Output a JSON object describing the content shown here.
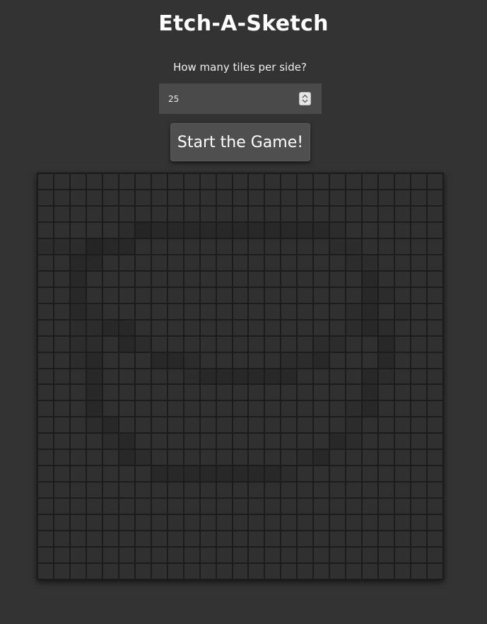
{
  "title": "Etch-A-Sketch",
  "prompt": "How many tiles per side?",
  "tiles_input": {
    "value": "25"
  },
  "start_button": {
    "label": "Start the Game!"
  },
  "grid": {
    "tiles_per_side": 25,
    "base_color": "#303030",
    "shaded": {
      "light": "#2c2c2c",
      "medium": "#282828",
      "dark": "#252525"
    },
    "drawn_tiles": [
      [
        3,
        5,
        "l"
      ],
      [
        3,
        6,
        "d"
      ],
      [
        3,
        7,
        "m"
      ],
      [
        3,
        8,
        "m"
      ],
      [
        3,
        9,
        "m"
      ],
      [
        3,
        10,
        "m"
      ],
      [
        3,
        11,
        "m"
      ],
      [
        3,
        12,
        "m"
      ],
      [
        3,
        13,
        "m"
      ],
      [
        3,
        14,
        "m"
      ],
      [
        3,
        15,
        "m"
      ],
      [
        3,
        16,
        "m"
      ],
      [
        3,
        17,
        "m"
      ],
      [
        3,
        18,
        "l"
      ],
      [
        4,
        0,
        "l"
      ],
      [
        4,
        1,
        "l"
      ],
      [
        4,
        2,
        "l"
      ],
      [
        4,
        3,
        "d"
      ],
      [
        4,
        4,
        "m"
      ],
      [
        4,
        5,
        "m"
      ],
      [
        4,
        18,
        "l"
      ],
      [
        4,
        19,
        "l"
      ],
      [
        5,
        2,
        "m"
      ],
      [
        5,
        3,
        "m"
      ],
      [
        5,
        19,
        "l"
      ],
      [
        5,
        20,
        "l"
      ],
      [
        6,
        2,
        "m"
      ],
      [
        6,
        20,
        "m"
      ],
      [
        7,
        2,
        "m"
      ],
      [
        7,
        20,
        "m"
      ],
      [
        7,
        21,
        "l"
      ],
      [
        8,
        2,
        "m"
      ],
      [
        8,
        3,
        "l"
      ],
      [
        8,
        19,
        "l"
      ],
      [
        8,
        20,
        "m"
      ],
      [
        8,
        22,
        "l"
      ],
      [
        9,
        2,
        "l"
      ],
      [
        9,
        3,
        "l"
      ],
      [
        9,
        4,
        "m"
      ],
      [
        9,
        5,
        "m"
      ],
      [
        9,
        19,
        "l"
      ],
      [
        9,
        20,
        "m"
      ],
      [
        9,
        21,
        "l"
      ],
      [
        10,
        2,
        "l"
      ],
      [
        10,
        3,
        "l"
      ],
      [
        10,
        5,
        "m"
      ],
      [
        10,
        6,
        "l"
      ],
      [
        10,
        17,
        "l"
      ],
      [
        10,
        18,
        "l"
      ],
      [
        10,
        21,
        "m"
      ],
      [
        11,
        2,
        "l"
      ],
      [
        11,
        3,
        "m"
      ],
      [
        11,
        7,
        "m"
      ],
      [
        11,
        8,
        "m"
      ],
      [
        11,
        9,
        "l"
      ],
      [
        11,
        15,
        "l"
      ],
      [
        11,
        16,
        "l"
      ],
      [
        11,
        17,
        "m"
      ],
      [
        11,
        21,
        "m"
      ],
      [
        12,
        3,
        "m"
      ],
      [
        12,
        9,
        "l"
      ],
      [
        12,
        10,
        "m"
      ],
      [
        12,
        11,
        "m"
      ],
      [
        12,
        12,
        "m"
      ],
      [
        12,
        13,
        "m"
      ],
      [
        12,
        14,
        "m"
      ],
      [
        12,
        15,
        "m"
      ],
      [
        12,
        20,
        "m"
      ],
      [
        12,
        21,
        "l"
      ],
      [
        13,
        3,
        "m"
      ],
      [
        13,
        20,
        "m"
      ],
      [
        14,
        3,
        "m"
      ],
      [
        14,
        19,
        "l"
      ],
      [
        14,
        20,
        "m"
      ],
      [
        15,
        3,
        "l"
      ],
      [
        15,
        4,
        "m"
      ],
      [
        15,
        19,
        "l"
      ],
      [
        16,
        4,
        "l"
      ],
      [
        16,
        5,
        "m"
      ],
      [
        16,
        18,
        "m"
      ],
      [
        16,
        19,
        "l"
      ],
      [
        17,
        5,
        "m"
      ],
      [
        17,
        6,
        "l"
      ],
      [
        17,
        16,
        "l"
      ],
      [
        17,
        17,
        "m"
      ],
      [
        18,
        7,
        "m"
      ],
      [
        18,
        8,
        "m"
      ],
      [
        18,
        9,
        "m"
      ],
      [
        18,
        10,
        "m"
      ],
      [
        18,
        11,
        "m"
      ],
      [
        18,
        12,
        "m"
      ],
      [
        18,
        13,
        "m"
      ],
      [
        18,
        14,
        "m"
      ],
      [
        18,
        15,
        "l"
      ]
    ]
  }
}
